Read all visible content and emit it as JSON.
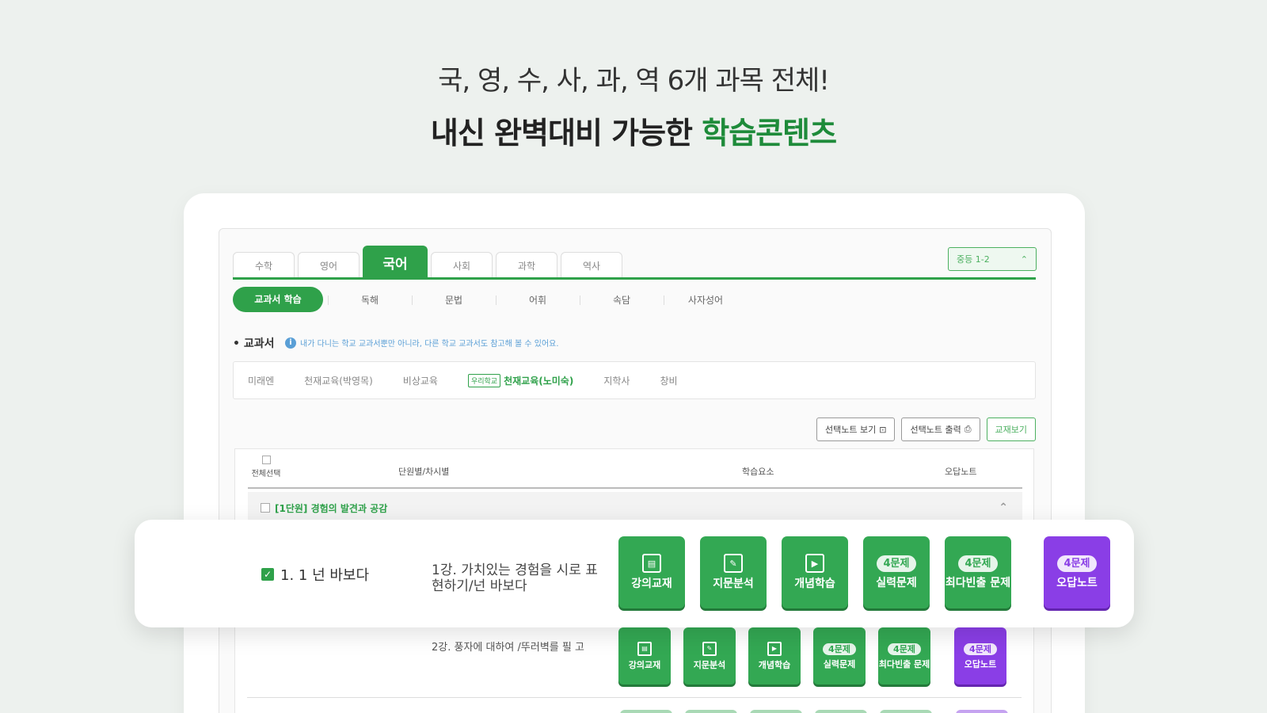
{
  "headline": {
    "line1": "국, 영, 수, 사, 과, 역 6개 과목 전체!",
    "line2_prefix": "내신 완벽대비 가능한 ",
    "line2_highlight": "학습콘텐츠"
  },
  "subject_tabs": [
    {
      "label": "수학",
      "active": false
    },
    {
      "label": "영어",
      "active": false
    },
    {
      "label": "국어",
      "active": true
    },
    {
      "label": "사회",
      "active": false
    },
    {
      "label": "과학",
      "active": false
    },
    {
      "label": "역사",
      "active": false
    }
  ],
  "grade_select": {
    "value": "중등 1-2"
  },
  "sub_tabs": [
    {
      "label": "교과서 학습",
      "active": true
    },
    {
      "label": "독해",
      "active": false
    },
    {
      "label": "문법",
      "active": false
    },
    {
      "label": "어휘",
      "active": false
    },
    {
      "label": "속담",
      "active": false
    },
    {
      "label": "사자성어",
      "active": false
    }
  ],
  "textbook": {
    "label": "• 교과서",
    "info": "내가 다니는 학교 교과서뿐만 아니라, 다른 학교 교과서도 참고해 볼 수 있어요."
  },
  "publishers": [
    {
      "label": "미래엔",
      "active": false
    },
    {
      "label": "천재교육(박영목)",
      "active": false
    },
    {
      "label": "비상교육",
      "active": false
    },
    {
      "label": "천재교육(노미숙)",
      "active": true,
      "badge": "우리학교"
    },
    {
      "label": "지학사",
      "active": false
    },
    {
      "label": "창비",
      "active": false
    }
  ],
  "actions": {
    "view_notes": "선택노트 보기",
    "print_notes": "선택노트 출력",
    "textbook_view": "교재보기"
  },
  "table": {
    "headers": {
      "select_all": "전체선택",
      "unit": "단원별/차시별",
      "elements": "학습요소",
      "wrong_note": "오답노트"
    },
    "unit_title": "[1단원] 경험의 발견과 공감"
  },
  "rows": [
    {
      "check_label": "1. 1 넌 바보다",
      "title": "1강. 가치있는 경험을 시로 표현하기/넌 바보다",
      "buttons": [
        {
          "label": "강의교재",
          "icon": "doc-icon",
          "badge": ""
        },
        {
          "label": "지문분석",
          "icon": "edit-icon",
          "badge": ""
        },
        {
          "label": "개념학습",
          "icon": "play-icon",
          "badge": ""
        },
        {
          "label": "실력문제",
          "icon": "",
          "badge": "4문제"
        },
        {
          "label": "최다빈출 문제",
          "icon": "",
          "badge": "4문제"
        },
        {
          "label": "오답노트",
          "icon": "",
          "badge": "4문제",
          "purple": true
        }
      ]
    },
    {
      "title": "2강. 풍자에 대하여 /뚜러벽를 필 고",
      "buttons": [
        {
          "label": "강의교재",
          "icon": "doc-icon",
          "badge": ""
        },
        {
          "label": "지문분석",
          "icon": "edit-icon",
          "badge": ""
        },
        {
          "label": "개념학습",
          "icon": "play-icon",
          "badge": ""
        },
        {
          "label": "실력문제",
          "icon": "",
          "badge": "4문제"
        },
        {
          "label": "최다빈출 문제",
          "icon": "",
          "badge": "4문제"
        },
        {
          "label": "오답노트",
          "icon": "",
          "badge": "4문제",
          "purple": true
        }
      ]
    }
  ],
  "colors": {
    "green": "#2fa14a",
    "purple": "#8a3ee6",
    "background": "#edf1ee"
  }
}
